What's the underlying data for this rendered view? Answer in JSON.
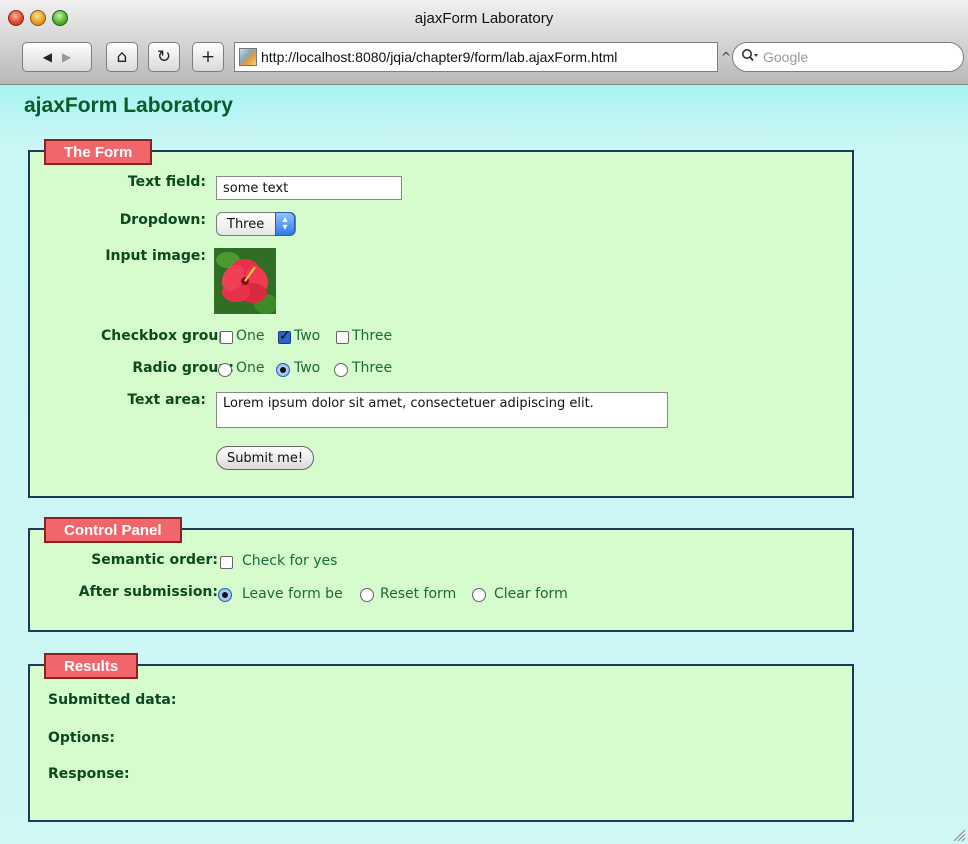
{
  "window": {
    "title": "ajaxForm Laboratory"
  },
  "toolbar": {
    "back_label": "◀",
    "forward_label": "▶",
    "home_label": "⌂",
    "reload_label": "↻",
    "add_label": "+",
    "url": "http://localhost:8080/jqia/chapter9/form/lab.ajaxForm.html",
    "snapback_label": "^",
    "search_placeholder": "Google"
  },
  "page": {
    "title": "ajaxForm Laboratory"
  },
  "form_section": {
    "legend": "The Form",
    "text_field": {
      "label": "Text field:",
      "value": "some text"
    },
    "dropdown": {
      "label": "Dropdown:",
      "selected": "Three"
    },
    "input_image": {
      "label": "Input image:"
    },
    "checkbox_group": {
      "label": "Checkbox group:",
      "options": [
        {
          "label": "One",
          "checked": false
        },
        {
          "label": "Two",
          "checked": true
        },
        {
          "label": "Three",
          "checked": false
        }
      ]
    },
    "radio_group": {
      "label": "Radio group:",
      "options": [
        {
          "label": "One",
          "checked": false
        },
        {
          "label": "Two",
          "checked": true
        },
        {
          "label": "Three",
          "checked": false
        }
      ]
    },
    "text_area": {
      "label": "Text area:",
      "value": "Lorem ipsum dolor sit amet, consectetuer adipiscing elit."
    },
    "submit_label": "Submit me!"
  },
  "control_panel": {
    "legend": "Control Panel",
    "semantic_order": {
      "label": "Semantic order:",
      "checkbox_label": "Check for yes",
      "checked": false
    },
    "after_submission": {
      "label": "After submission:",
      "options": [
        {
          "label": "Leave form be",
          "checked": true
        },
        {
          "label": "Reset form",
          "checked": false
        },
        {
          "label": "Clear form",
          "checked": false
        }
      ]
    }
  },
  "results": {
    "legend": "Results",
    "submitted_data_label": "Submitted data:",
    "options_label": "Options:",
    "response_label": "Response:"
  },
  "colors": {
    "legend_bg": "#f0666a",
    "fieldset_bg": "#d6fbcc",
    "fieldset_border": "#1d3a5c",
    "label_text": "#0a4a1e",
    "page_bg_top": "#3fe3e0"
  }
}
